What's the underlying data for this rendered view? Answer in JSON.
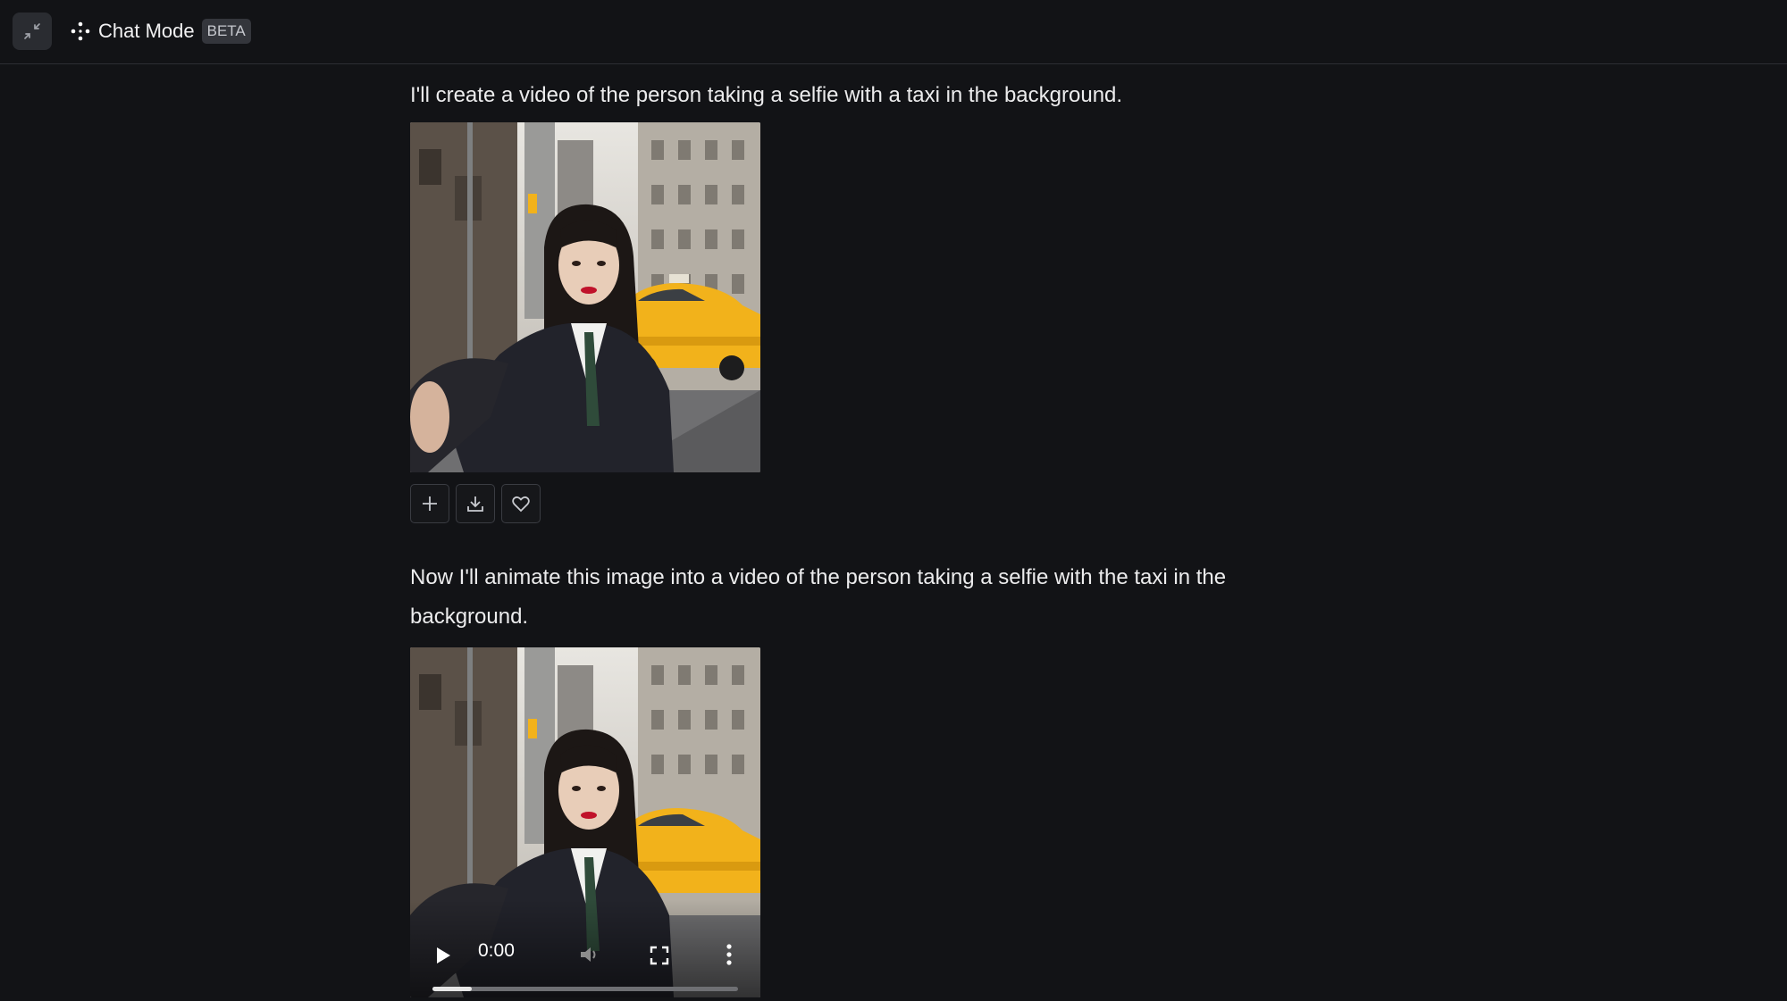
{
  "header": {
    "mode_title": "Chat Mode",
    "badge": "BETA",
    "icons": [
      "collapse-icon",
      "sparkle-dots-icon"
    ]
  },
  "messages": [
    {
      "text": "I'll create a video of the person taking a selfie with a taxi in the background."
    },
    {
      "text": "Now I'll animate this image into a video of the person taking a selfie with the taxi in the background."
    }
  ],
  "image_actions": [
    "plus-icon",
    "download-icon",
    "heart-icon"
  ],
  "video": {
    "time": "0:00",
    "progress": 0.13,
    "controls": [
      "play-icon",
      "mute-icon",
      "fullscreen-icon",
      "more-vertical-icon"
    ]
  },
  "colors": {
    "background": "#121316",
    "taxi_yellow": "#f2b21b"
  }
}
